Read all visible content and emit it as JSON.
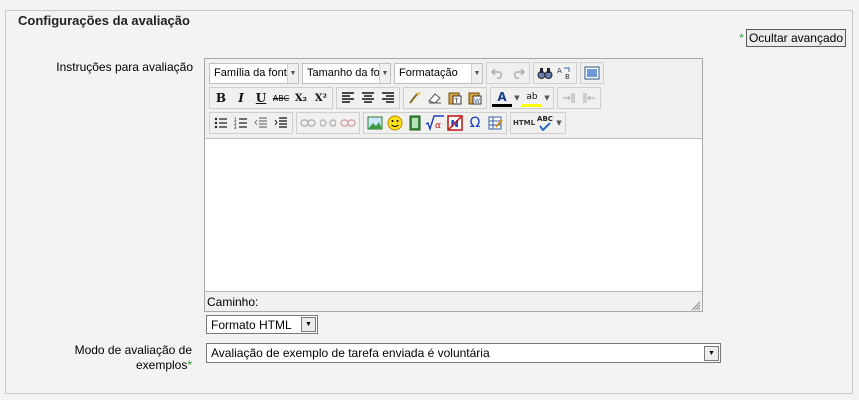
{
  "section": {
    "legend": "Configurações da avaliação",
    "advanced_button": "Ocultar avançado",
    "required_mark": "*"
  },
  "instructions": {
    "label": "Instruções para avaliação",
    "font_family": "Família da font",
    "font_size": "Tamanho da fo",
    "format_block": "Formatação",
    "path_label": "Caminho:",
    "text_format": "Formato HTML"
  },
  "mode": {
    "label_line1": "Modo de avaliação de",
    "label_line2": "exemplos",
    "required_mark": "*",
    "selected": "Avaliação de exemplo de tarefa enviada é voluntária"
  },
  "toolbar_icons": {
    "row1": [
      "undo-icon",
      "redo-icon",
      "find-icon",
      "replace-icon",
      "fullscreen-icon"
    ],
    "row2": [
      "bold-icon",
      "italic-icon",
      "underline-icon",
      "strikethrough-icon",
      "subscript-icon",
      "superscript-icon",
      "align-left-icon",
      "align-center-icon",
      "align-right-icon",
      "cleanup-icon",
      "remove-format-icon",
      "paste-text-icon",
      "paste-word-icon",
      "text-color-icon",
      "highlight-color-icon",
      "ltr-icon",
      "rtl-icon"
    ],
    "row3": [
      "bullet-list-icon",
      "numbered-list-icon",
      "outdent-icon",
      "indent-icon",
      "link-icon",
      "unlink-icon",
      "anchor-icon",
      "image-icon",
      "emoticon-icon",
      "media-icon",
      "equation-icon",
      "nolink-icon",
      "special-char-icon",
      "table-icon",
      "html-source-icon",
      "spellcheck-icon"
    ]
  },
  "toolbar_glyphs": {
    "bold": "B",
    "italic": "I",
    "underline": "U",
    "strike": "ABC",
    "sub": "X₂",
    "sup": "X²",
    "omega": "Ω",
    "html": "HTML",
    "abc": "ABC",
    "text_color": "A",
    "highlight": "ab"
  },
  "colors": {
    "required": "#2e9b2e",
    "background": "#f3f3f3",
    "editor_toolbar": "#f0f0ee"
  }
}
